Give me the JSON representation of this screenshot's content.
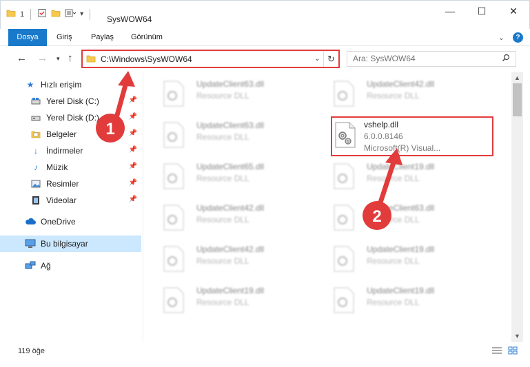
{
  "window": {
    "title": "SysWOW64",
    "minimize_label": "—",
    "maximize_label": "☐",
    "close_label": "✕",
    "quick_access_number": "1"
  },
  "ribbon": {
    "tabs": [
      {
        "label": "Dosya",
        "active": true
      },
      {
        "label": "Giriş"
      },
      {
        "label": "Paylaş"
      },
      {
        "label": "Görünüm"
      }
    ],
    "collapse_icon": "chevron-down-icon",
    "help_label": "?"
  },
  "address": {
    "path": "C:\\Windows\\SysWOW64",
    "refresh_icon": "refresh-icon"
  },
  "search": {
    "placeholder": "Ara: SysWOW64"
  },
  "sidebar": {
    "quick_access": "Hızlı erişim",
    "items": [
      {
        "label": "Yerel Disk (C:)",
        "icon": "drive-icon",
        "pinned": true
      },
      {
        "label": "Yerel Disk (D:)",
        "icon": "drive-icon",
        "pinned": true
      },
      {
        "label": "Belgeler",
        "icon": "documents-icon",
        "pinned": true
      },
      {
        "label": "İndirmeler",
        "icon": "download-icon",
        "pinned": true
      },
      {
        "label": "Müzik",
        "icon": "music-icon",
        "pinned": true
      },
      {
        "label": "Resimler",
        "icon": "pictures-icon",
        "pinned": true
      },
      {
        "label": "Videolar",
        "icon": "video-icon",
        "pinned": true
      }
    ],
    "onedrive": "OneDrive",
    "this_pc": "Bu bilgisayar",
    "network": "Ağ"
  },
  "files": {
    "left_column": [
      {
        "name": "UpdateClient63.dll",
        "type": "Resource DLL"
      },
      {
        "name": "UpdateClient63.dll",
        "type": "Resource DLL"
      },
      {
        "name": "UpdateClient65.dll",
        "type": "Resource DLL"
      },
      {
        "name": "UpdateClient42.dll",
        "type": "Resource DLL"
      },
      {
        "name": "UpdateClient42.dll",
        "type": "Resource DLL"
      },
      {
        "name": "UpdateClient19.dll",
        "type": "Resource DLL"
      }
    ],
    "right_column": [
      {
        "name": "UpdateClient42.dll",
        "type": "Resource DLL"
      },
      {
        "name": "UpdateClient19.dll",
        "type": "Resource DLL"
      },
      {
        "name": "UpdateClient63.dll",
        "type": "Resource DLL"
      },
      {
        "name": "UpdateClient19.dll",
        "type": "Resource DLL"
      },
      {
        "name": "UpdateClient19.dll",
        "type": "Resource DLL"
      }
    ],
    "highlighted": {
      "name": "vshelp.dll",
      "version": "6.0.0.8146",
      "company": "Microsoft(R) Visual..."
    }
  },
  "status": {
    "item_count": "119 öğe"
  },
  "annotations": {
    "badge1": "1",
    "badge2": "2",
    "color": "#e23b3b"
  }
}
